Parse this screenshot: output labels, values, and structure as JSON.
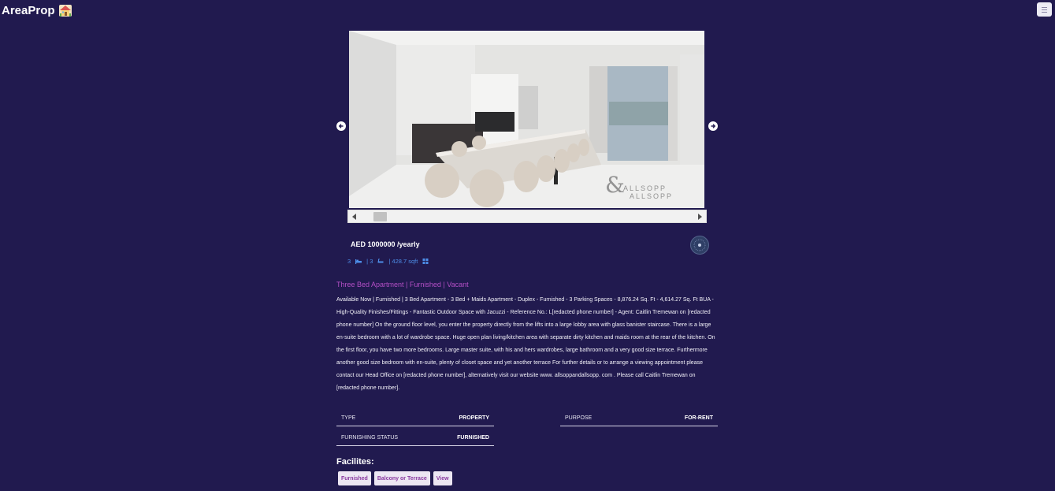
{
  "app": {
    "title": "AreaProp",
    "logo_icon": "house-emoji-icon",
    "menu_icon": "hamburger-icon"
  },
  "gallery": {
    "image_watermark": "ALLSOPP & ALLSOPP",
    "prev_icon": "arrow-left-circle-icon",
    "next_icon": "arrow-right-circle-icon"
  },
  "listing": {
    "price": "AED 1000000",
    "price_period": " /yearly",
    "rooms": "3",
    "baths": "| 3",
    "area": "| 428.7 sqft",
    "title": "Three Bed Apartment | Furnished | Vacant",
    "description": "Available Now | Furnished | 3 Bed Apartment - 3 Bed + Maids Apartment - Duplex - Furnished - 3 Parking Spaces - 8,876.24 Sq. Ft - 4,614.27 Sq. Ft BUA - High-Quality Finishes/Fittings - Fantastic Outdoor Space with Jacuzzi - Reference No.: L[redacted phone number] - Agent: Caitlin Tremewan on [redacted phone number] On the ground floor level, you enter the property directly from the lifts into a large lobby area with glass banister staircase. There is a large en-suite bedroom with a lot of wardrobe space. Huge open plan living/kitchen area with separate dirty kitchen and maids room at the rear of the kitchen. On the first floor, you have two more bedrooms. Large master suite, with his and hers wardrobes, large bathroom and a very good size terrace. Furthermore another good size bedroom with en-suite, plenty of closet space and yet another terrace For further details or to arrange a viewing appointment please contact our Head Office on [redacted phone number], alternatively visit our website www. allsoppandallsopp. com . Please call Caitlin Tremewan on [redacted phone number]."
  },
  "details": {
    "type_label": "Type",
    "type_value": "Property",
    "purpose_label": "Purpose",
    "purpose_value": "For-Rent",
    "furnishing_label": "Furnishing Status",
    "furnishing_value": "Furnished"
  },
  "facilities": {
    "heading": "Facilites:",
    "items": [
      "Furnished",
      "Balcony or Terrace",
      "View"
    ]
  }
}
